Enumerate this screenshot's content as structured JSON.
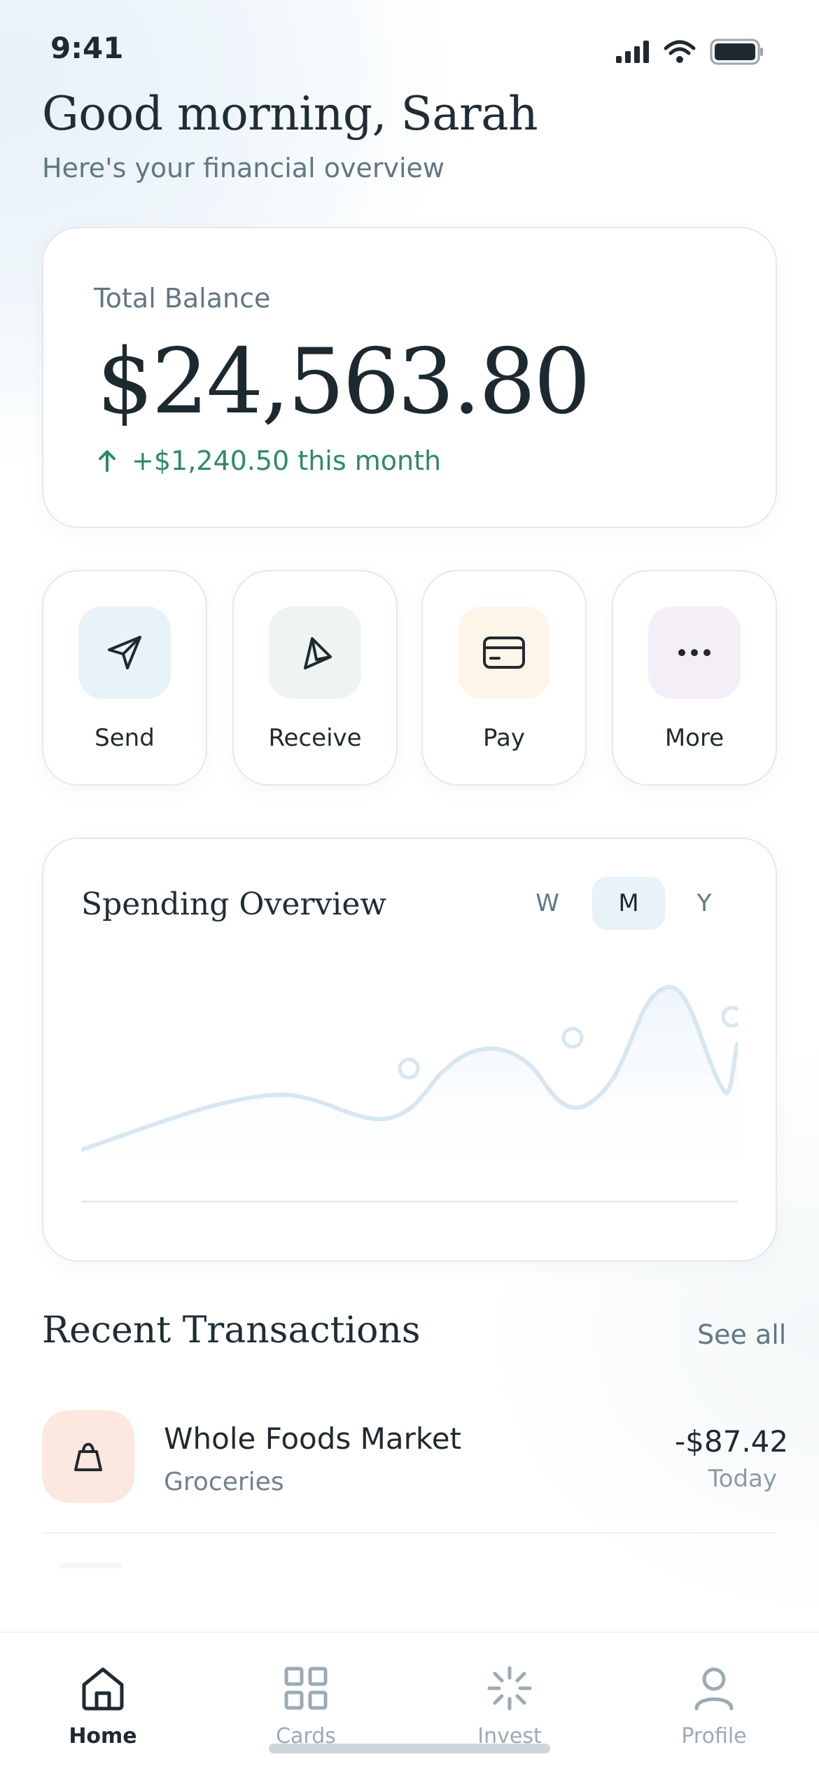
{
  "status_bar": {
    "time": "9:41"
  },
  "header": {
    "greeting": "Good morning, Sarah",
    "subtitle": "Here's your financial overview"
  },
  "balance": {
    "label": "Total Balance",
    "value": "$24,563.80",
    "change": "+$1,240.50 this month",
    "change_color": "#2e8a66"
  },
  "actions": [
    {
      "label": "Send",
      "icon": "send-icon",
      "tint": "#e8f3f9"
    },
    {
      "label": "Receive",
      "icon": "receive-icon",
      "tint": "#eef4f2"
    },
    {
      "label": "Pay",
      "icon": "card-icon",
      "tint": "#fdf5e8"
    },
    {
      "label": "More",
      "icon": "more-icon",
      "tint": "#f4eff7"
    }
  ],
  "spending": {
    "title": "Spending Overview",
    "periods": [
      "W",
      "M",
      "Y"
    ],
    "selected_period": "M",
    "line_color": "#d5e7f2"
  },
  "transactions": {
    "title": "Recent Transactions",
    "see_all": "See all",
    "items": [
      {
        "name": "Whole Foods Market",
        "category": "Groceries",
        "amount": "-$87.42",
        "date": "Today",
        "icon": "shopping-bag-icon",
        "tint": "#fce8df"
      }
    ]
  },
  "nav": {
    "items": [
      {
        "label": "Home",
        "icon": "home-icon",
        "active": true
      },
      {
        "label": "Cards",
        "icon": "grid-icon",
        "active": false
      },
      {
        "label": "Invest",
        "icon": "loader-icon",
        "active": false
      },
      {
        "label": "Profile",
        "icon": "user-icon",
        "active": false
      }
    ]
  }
}
